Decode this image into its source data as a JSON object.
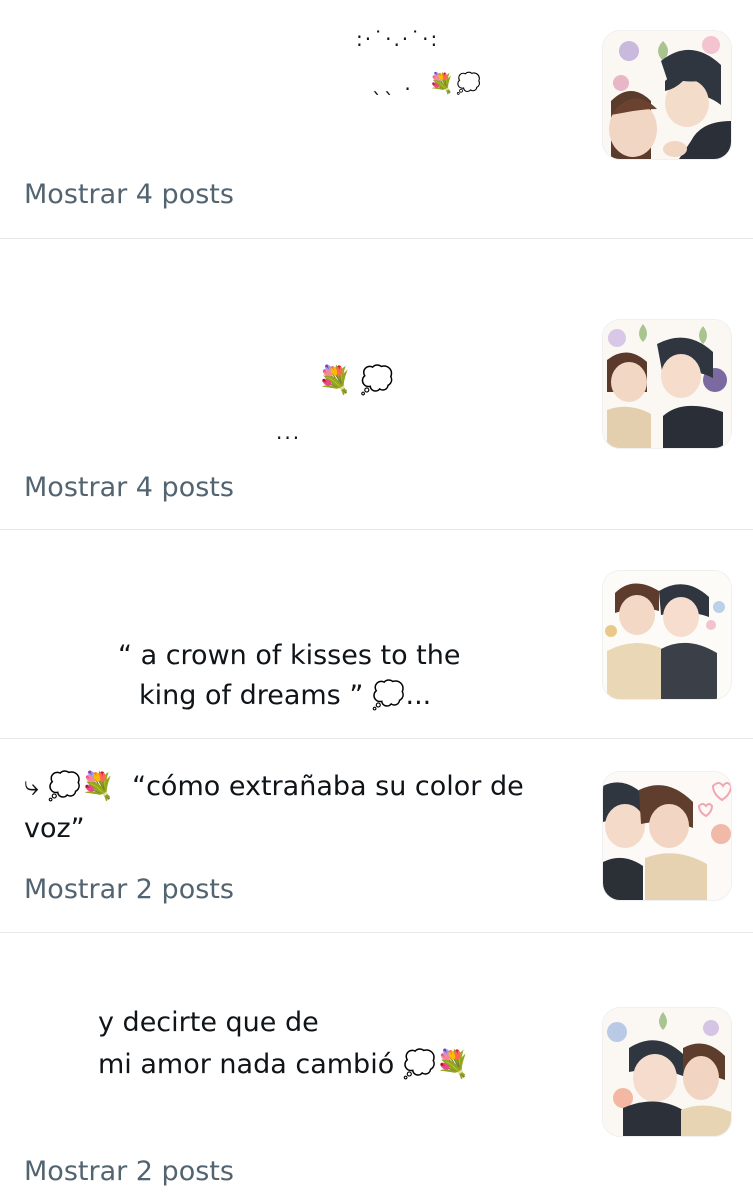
{
  "posts": [
    {
      "lines": [
        ":·˙·.·˙·:",
        "ˎˎ .  💐💭"
      ],
      "show_more": "Mostrar 4 posts",
      "thumbnail": "illustration of two boys, flowers background"
    },
    {
      "lines": [
        "💐 💭",
        "..."
      ],
      "show_more": "Mostrar 4 posts",
      "thumbnail": "illustration of two boys cheek to cheek"
    },
    {
      "lines": [
        "“ a crown of kisses to the",
        "king of dreams ” 💭..."
      ],
      "thumbnail": "illustration of two boys kissing cheek"
    },
    {
      "lines": [
        "⤷ 💭💐  “cómo extrañaba su color de",
        "voz”"
      ],
      "show_more": "Mostrar 2 posts",
      "thumbnail": "illustration of two boys with hearts"
    },
    {
      "lines": [
        "y decirte que de",
        "mi amor nada cambió 💭💐"
      ],
      "show_more": "Mostrar 2 posts",
      "thumbnail": "illustration of two boys embracing, flowers"
    }
  ],
  "colors": {
    "text": "#0f1419",
    "muted": "#536471",
    "divider": "#e6e9eb"
  }
}
